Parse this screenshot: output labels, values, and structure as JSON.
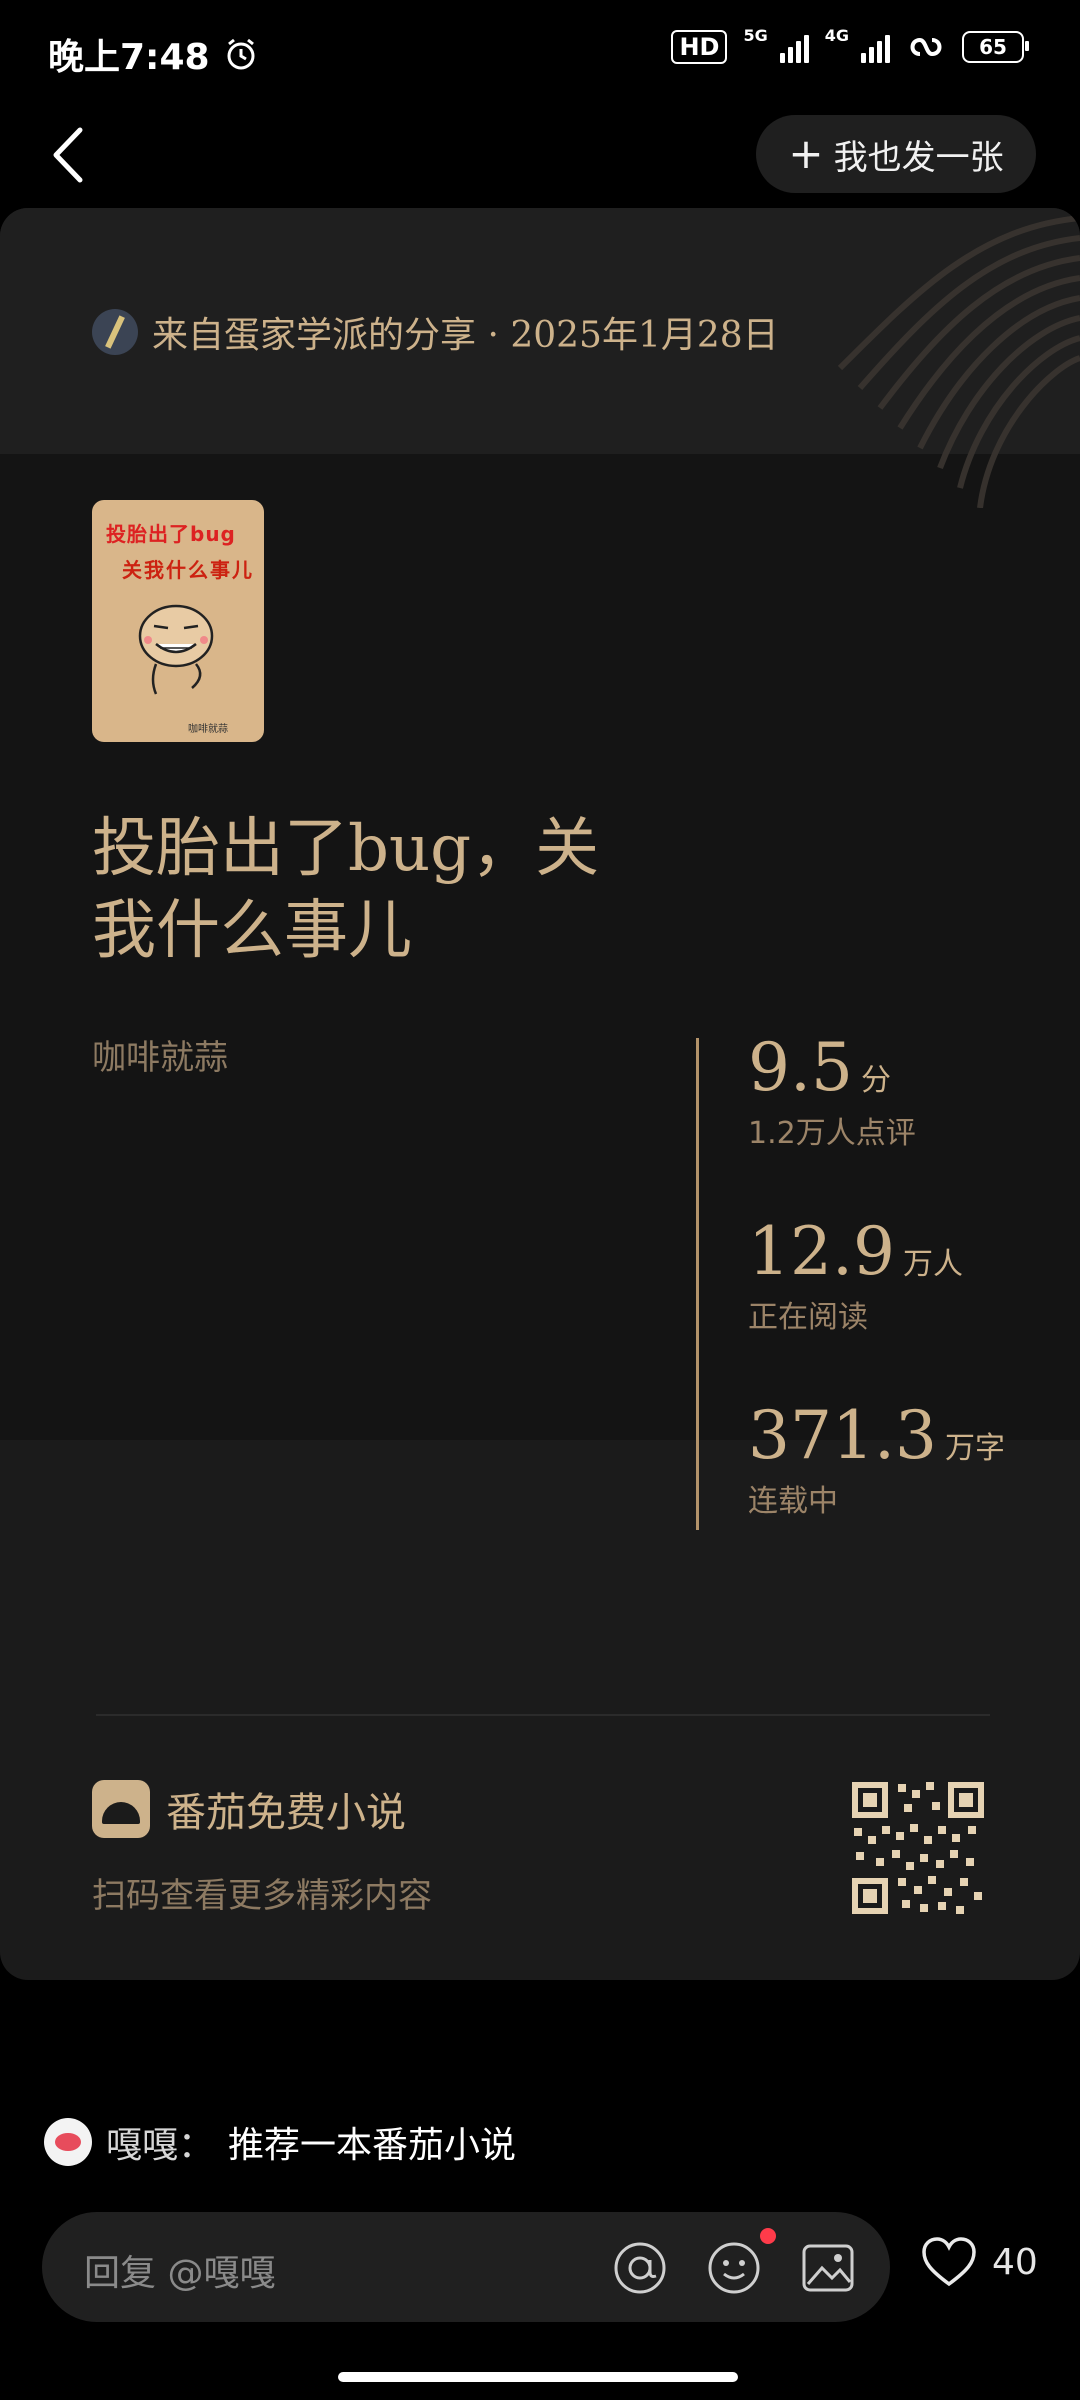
{
  "status_bar": {
    "time": "晚上7:48",
    "hd_label": "HD",
    "net_5g": "5G",
    "net_4g": "4G",
    "battery": "65"
  },
  "header": {
    "publish_label": "我也发一张"
  },
  "card": {
    "share_text": "来自蛋家学派的分享 · 2025年1月28日",
    "cover": {
      "line1": "投胎出了bug",
      "line2": "关我什么事儿",
      "author": "咖啡就蒜"
    },
    "book_title_line1": "投胎出了bug，关",
    "book_title_line2": "我什么事儿",
    "author": "咖啡就蒜",
    "stats": [
      {
        "value": "9.5",
        "unit": "分",
        "label": "1.2万人点评"
      },
      {
        "value": "12.9",
        "unit": "万人",
        "label": "正在阅读"
      },
      {
        "value": "371.3",
        "unit": "万字",
        "label": "连载中"
      }
    ],
    "app_name": "番茄免费小说",
    "app_sub": "扫码查看更多精彩内容"
  },
  "comment": {
    "name": "嘎嘎：",
    "text": "推荐一本番茄小说"
  },
  "reply": {
    "placeholder": "回复 @嘎嘎"
  },
  "like_count": "40",
  "colors": {
    "accent_gold": "#cdb28b",
    "card_bg": "#1b1b1b",
    "notification_red": "#ff3b4a"
  }
}
